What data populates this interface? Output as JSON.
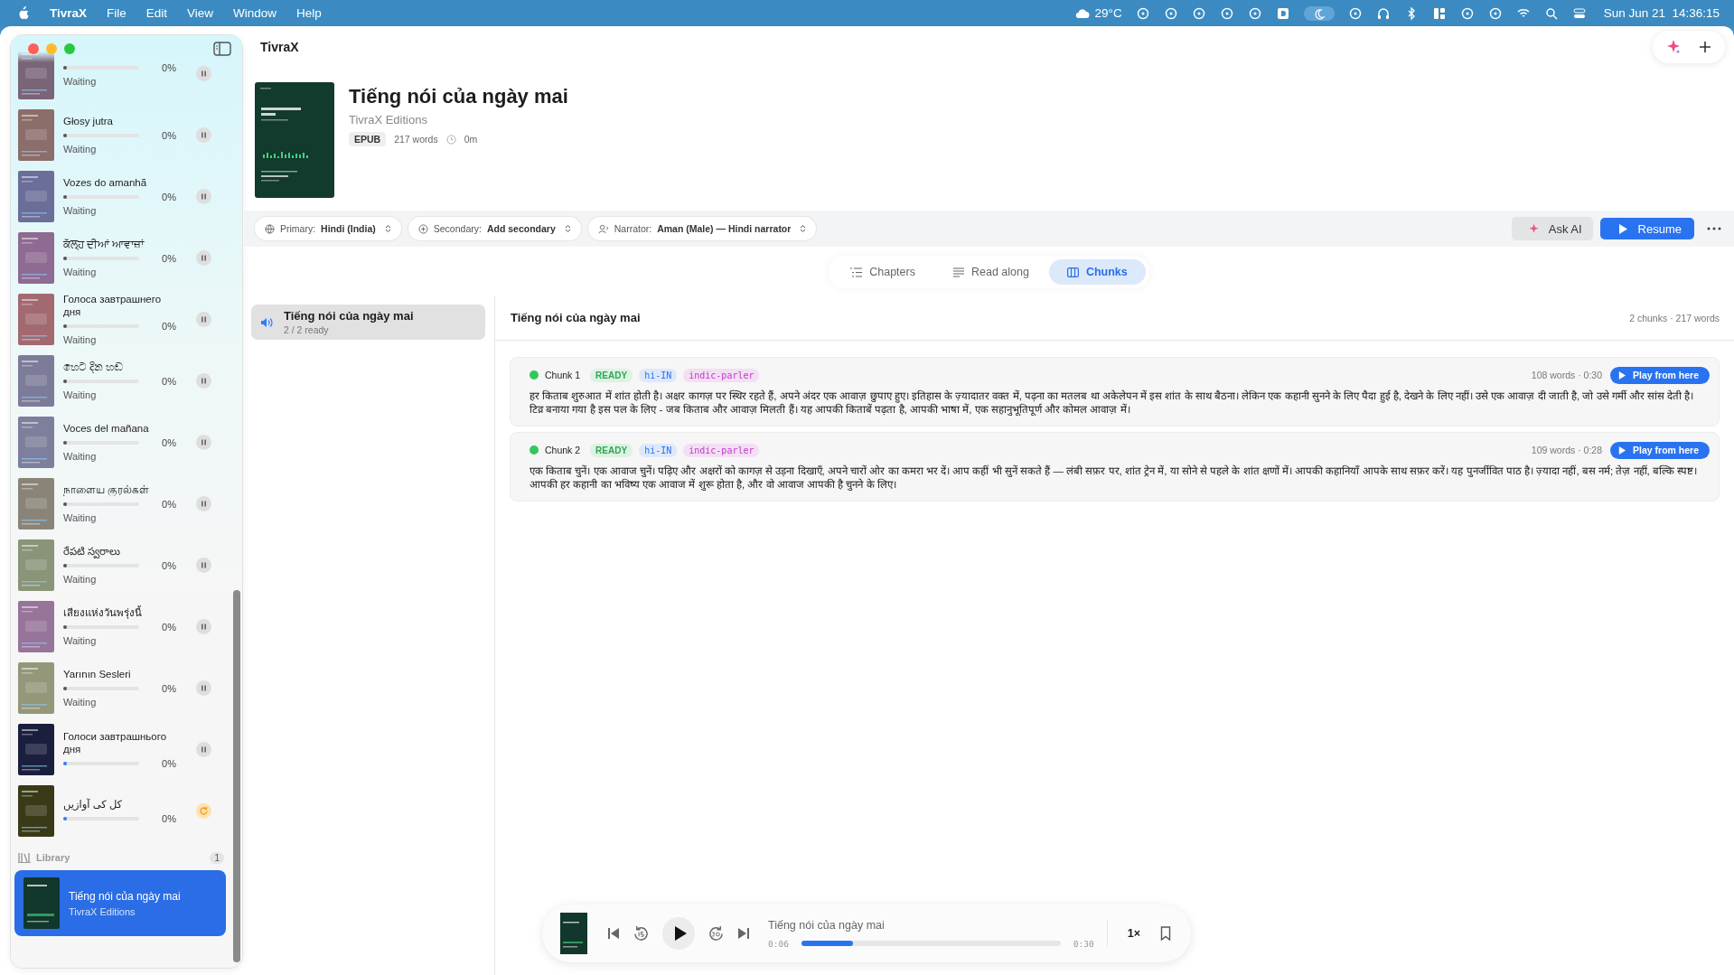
{
  "menu_bar": {
    "app_name": "TivraX",
    "menus": [
      "File",
      "Edit",
      "View",
      "Window",
      "Help"
    ],
    "temperature": "29°C",
    "clock": "Sun Jun 21  14:36:15"
  },
  "window": {
    "title": "TivraX"
  },
  "sidebar": {
    "queue": [
      {
        "percent": "0%",
        "status": "Waiting",
        "level": 0,
        "started": false,
        "kind": "pause",
        "color": "#7a6478"
      },
      {
        "title": "Głosy jutra",
        "percent": "0%",
        "status": "Waiting",
        "level": 0,
        "started": false,
        "kind": "pause",
        "color": "#8b6d6a"
      },
      {
        "title": "Vozes do amanhã",
        "percent": "0%",
        "status": "Waiting",
        "level": 0,
        "started": false,
        "kind": "pause",
        "color": "#6b6e98"
      },
      {
        "title": "ਕੱਲ੍ਹ ਦੀਆਂ ਆਵਾਜ਼ਾਂ",
        "percent": "0%",
        "status": "Waiting",
        "level": 0,
        "started": false,
        "kind": "pause",
        "color": "#8f6a92"
      },
      {
        "title": "Голоса завтрашнего дня",
        "percent": "0%",
        "status": "Waiting",
        "level": 0,
        "started": false,
        "kind": "pause",
        "color": "#a26a70"
      },
      {
        "title": "හෙට දින හඬ",
        "percent": "0%",
        "status": "Waiting",
        "level": 0,
        "started": false,
        "kind": "pause",
        "color": "#7c7c9a"
      },
      {
        "title": "Voces del mañana",
        "percent": "0%",
        "status": "Waiting",
        "level": 0,
        "started": false,
        "kind": "pause",
        "color": "#7d7f9c"
      },
      {
        "title": "நாளைய குரல்கள்",
        "percent": "0%",
        "status": "Waiting",
        "level": 0,
        "started": false,
        "kind": "pause",
        "color": "#8a8478"
      },
      {
        "title": "రేపటి స్వరాలు",
        "percent": "0%",
        "status": "Waiting",
        "level": 0,
        "started": false,
        "kind": "pause",
        "color": "#8a9478"
      },
      {
        "title": "เสียงแห่งวันพรุ่งนี้",
        "percent": "0%",
        "status": "Waiting",
        "level": 0,
        "started": false,
        "kind": "pause",
        "color": "#97759a"
      },
      {
        "title": "Yarının Sesleri",
        "percent": "0%",
        "status": "Waiting",
        "level": 0,
        "started": false,
        "kind": "pause",
        "color": "#94977a"
      },
      {
        "title": "Голоси завтрашнього дня",
        "percent": "0%",
        "level": 0,
        "started": true,
        "kind": "pause",
        "color": "#1a1f3d"
      },
      {
        "title": "کل کی آوازیں",
        "percent": "0%",
        "level": 0,
        "started": true,
        "kind": "retry",
        "color": "#3a3a18"
      }
    ],
    "library": {
      "label": "Library",
      "count": "1",
      "items": [
        {
          "title": "Tiếng nói của ngày mai",
          "author": "TivraX Editions",
          "selected": true
        }
      ]
    }
  },
  "book": {
    "title": "Tiếng nói của ngày mai",
    "author": "TivraX Editions",
    "format": "EPUB",
    "words": "217 words",
    "duration": "0m"
  },
  "toolbar": {
    "selectors": [
      {
        "label": "Primary:",
        "value": "Hindi (India)",
        "kind": "globe"
      },
      {
        "label": "Secondary:",
        "value": "Add secondary",
        "kind": "plus"
      },
      {
        "label": "Narrator:",
        "value": "Aman (Male) — Hindi narrator",
        "kind": "person"
      }
    ],
    "ask_ai": "Ask AI",
    "resume": "Resume"
  },
  "tabs": [
    {
      "label": "Chapters",
      "selected": false,
      "kind": "list"
    },
    {
      "label": "Read along",
      "selected": false,
      "kind": "lines"
    },
    {
      "label": "Chunks",
      "selected": true,
      "kind": "columns"
    }
  ],
  "chapters": [
    {
      "title": "Tiếng nói của ngày mai",
      "progress": "2 / 2 ready",
      "selected": true
    }
  ],
  "chunk_panel": {
    "title": "Tiếng nói của ngày mai",
    "summary": "2 chunks · 217 words",
    "chunks": [
      {
        "name": "Chunk 1",
        "status": "READY",
        "language": "hi-IN",
        "model": "indic-parler",
        "meta": "108 words · 0:30",
        "action": "Play from here",
        "color": "#34c759",
        "text": "हर किताब शुरुआत में शांत होती है। अक्षर कागज़ पर स्थिर रहते हैं, अपने अंदर एक आवाज़ छुपाए हुए। इतिहास के ज़्यादातर वक्त में, पढ़ना का मतलब था अकेलेपन में इस शांत के साथ बैठना। लेकिन एक कहानी सुनने के लिए पैदा हुई है, देखने के लिए नहीं। उसे एक आवाज़ दी जाती है, जो उसे गर्मी और सांस देती है। टिव्र बनाया गया है इस पल के लिए - जब किताब और आवाज़ मिलती हैं। यह आपकी किताबें पढ़ता है, आपकी भाषा में, एक सहानुभूतिपूर्ण और कोमल आवाज़ में।"
      },
      {
        "name": "Chunk 2",
        "status": "READY",
        "language": "hi-IN",
        "model": "indic-parler",
        "meta": "109 words · 0:28",
        "action": "Play from here",
        "color": "#34c759",
        "text": "एक किताब चुनें। एक आवाज चुनें। पढ़िए और अक्षरों को कागज़ से उड़ना दिखाएँ, अपने चारों ओर का कमरा भर दें। आप कहीं भी सुनें सकते हैं — लंबी सफ़र पर, शांत ट्रेन में, या सोने से पहले के शांत क्षणों में। आपकी कहानियाँ आपके साथ सफ़र करें। यह पुनर्जीवित पाठ है। ज़्यादा नहीं, बस नर्म; तेज़ नहीं, बल्कि स्पष्ट। आपकी हर कहानी का भविष्य एक आवाज में शुरू होता है, और वो आवाज आपकी है चुनने के लिए।"
      }
    ]
  },
  "player": {
    "title": "Tiếng nói của ngày mai",
    "elapsed": "0:06",
    "total": "0:30",
    "level": 0.2,
    "speed": "1×"
  }
}
